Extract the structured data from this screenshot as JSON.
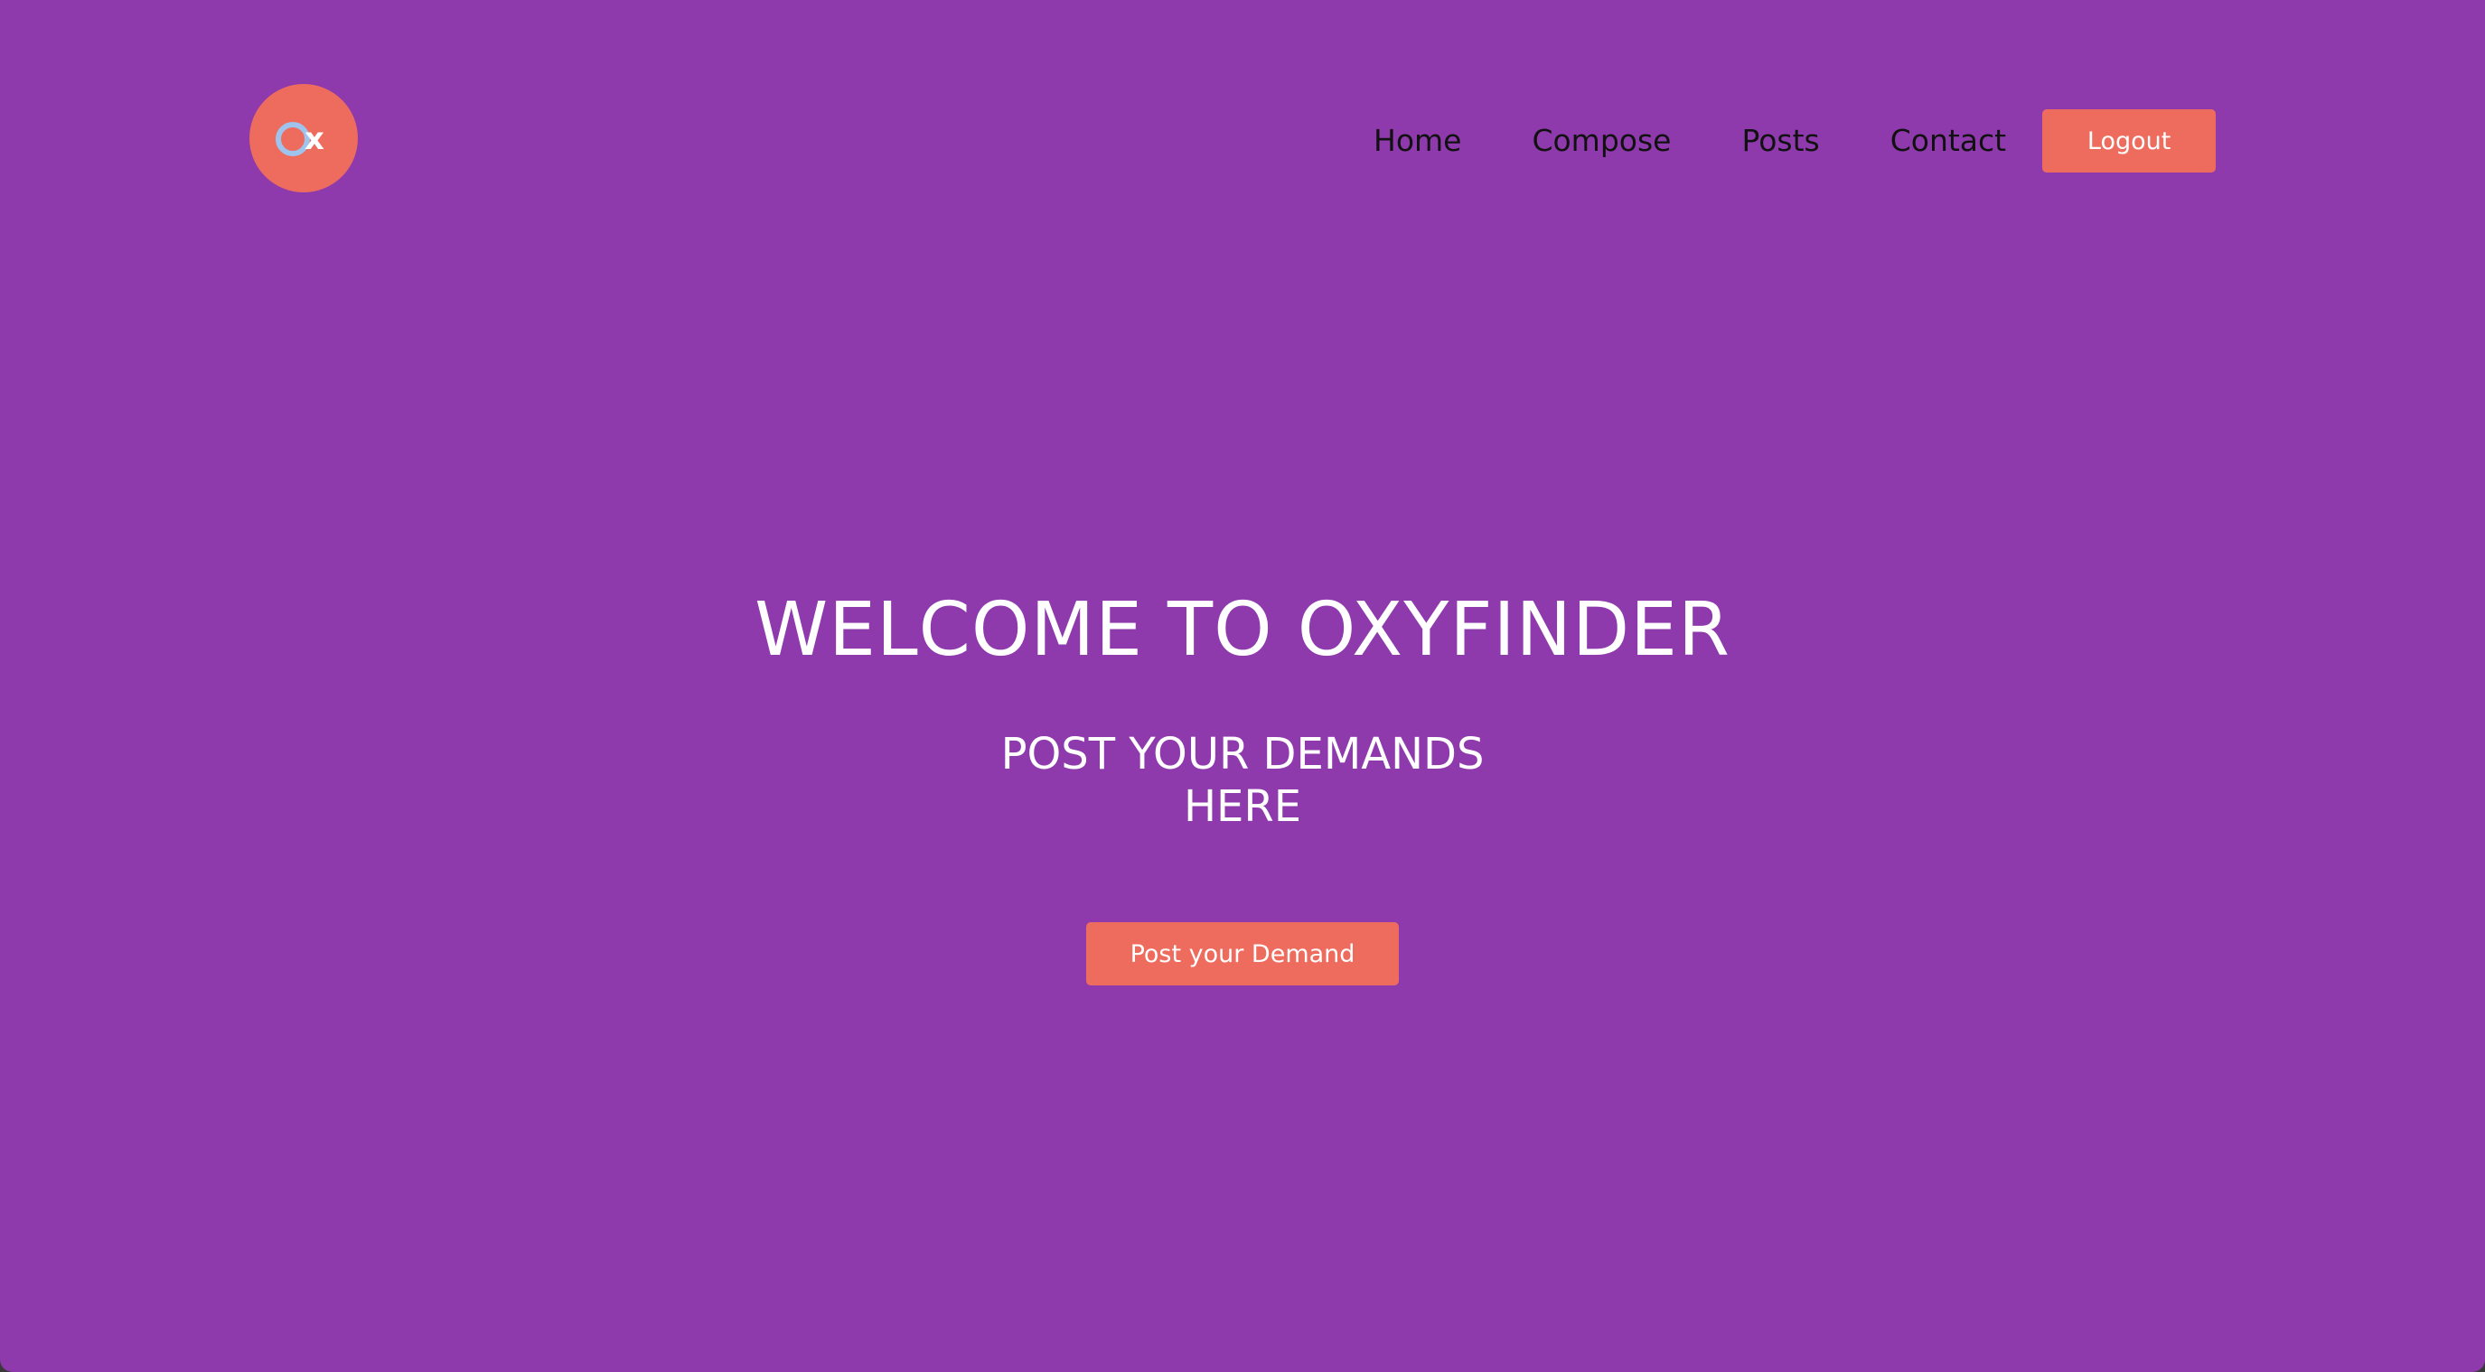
{
  "brand": {
    "logo_letters": "Ox"
  },
  "nav": {
    "items": [
      "Home",
      "Compose",
      "Posts",
      "Contact"
    ],
    "logout_label": "Logout"
  },
  "hero": {
    "title": "WELCOME TO OXYFINDER",
    "subtitle_line1": "POST YOUR DEMANDS",
    "subtitle_line2": "HERE",
    "cta_label": "Post your Demand"
  },
  "colors": {
    "background": "#8e3aad",
    "accent": "#ee6c5e",
    "logo_o": "#9ec4ee",
    "nav_text": "#111111",
    "hero_text": "#ffffff"
  }
}
